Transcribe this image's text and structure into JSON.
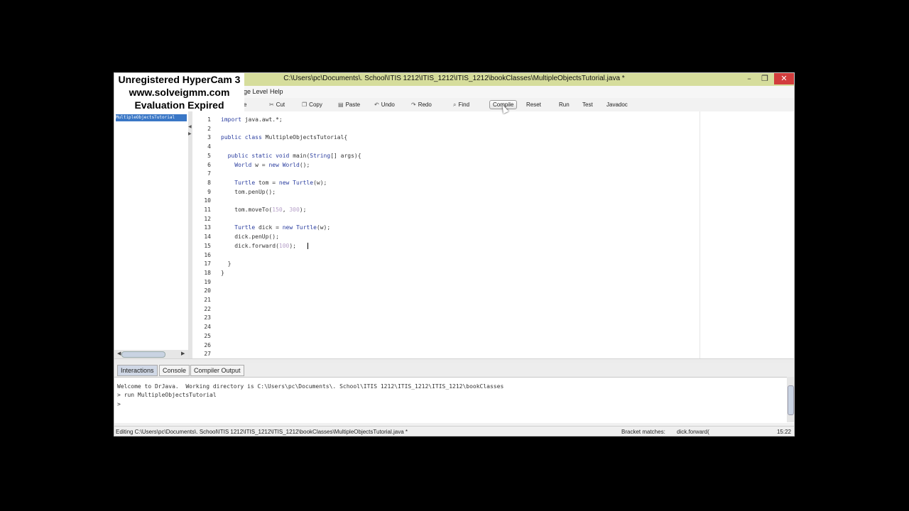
{
  "window": {
    "title": "C:\\Users\\pc\\Documents\\. School\\ITIS 1212\\ITIS_1212\\ITIS_1212\\bookClasses\\MultipleObjectsTutorial.java *",
    "minimize": "–",
    "maximize": "❐",
    "close": "✕"
  },
  "watermark": {
    "line1": "Unregistered HyperCam 3",
    "line2": "www.solveigmm.com",
    "line3": "Evaluation Expired"
  },
  "menu": {
    "partial": "ge Level",
    "help": "Help"
  },
  "toolbar": {
    "partial_label": "e",
    "cut": "Cut",
    "copy": "Copy",
    "paste": "Paste",
    "undo": "Undo",
    "redo": "Redo",
    "find": "Find",
    "compile": "Compile",
    "reset": "Reset",
    "run": "Run",
    "test": "Test",
    "javadoc": "Javadoc"
  },
  "icons": {
    "cut": "scissors-icon",
    "copy": "copy-icon",
    "paste": "paste-icon",
    "undo": "undo-icon",
    "redo": "redo-icon",
    "find": "binoculars-icon"
  },
  "files": [
    "MultipleObjectsTutorial"
  ],
  "editor": {
    "line_numbers": [
      "1",
      "2",
      "3",
      "4",
      "5",
      "6",
      "7",
      "8",
      "9",
      "10",
      "11",
      "12",
      "13",
      "14",
      "15",
      "16",
      "17",
      "18",
      "19",
      "20",
      "21",
      "22",
      "23",
      "24",
      "25",
      "26",
      "27"
    ],
    "lines": [
      "import java.awt.*;",
      "",
      "public class MultipleObjectsTutorial{",
      "",
      "  public static void main(String[] args){",
      "    World w = new World();",
      "",
      "    Turtle tom = new Turtle(w);",
      "    tom.penUp();",
      "",
      "    tom.moveTo(150, 300);",
      "",
      "    Turtle dick = new Turtle(w);",
      "    dick.penUp();",
      "    dick.forward(100);",
      "",
      "  }",
      "}"
    ]
  },
  "tabs": {
    "interactions": "Interactions",
    "console": "Console",
    "compiler_output": "Compiler Output"
  },
  "interactions": {
    "lines": [
      "Welcome to DrJava.  Working directory is C:\\Users\\pc\\Documents\\. School\\ITIS 1212\\ITIS_1212\\ITIS_1212\\bookClasses",
      "> run MultipleObjectsTutorial",
      ">"
    ]
  },
  "status": {
    "editing": "Editing C:\\Users\\pc\\Documents\\. School\\ITIS 1212\\ITIS_1212\\ITIS_1212\\bookClasses\\MultipleObjectsTutorial.java *",
    "bracket_matches_label": "Bracket matches:",
    "bracket_matches_value": "dick.forward(",
    "position": "15:22"
  },
  "colors": {
    "titlebar": "#d6dd9c",
    "keyword": "#2a3d9f",
    "number": "#b7a1c9",
    "selection": "#3a77c6"
  }
}
